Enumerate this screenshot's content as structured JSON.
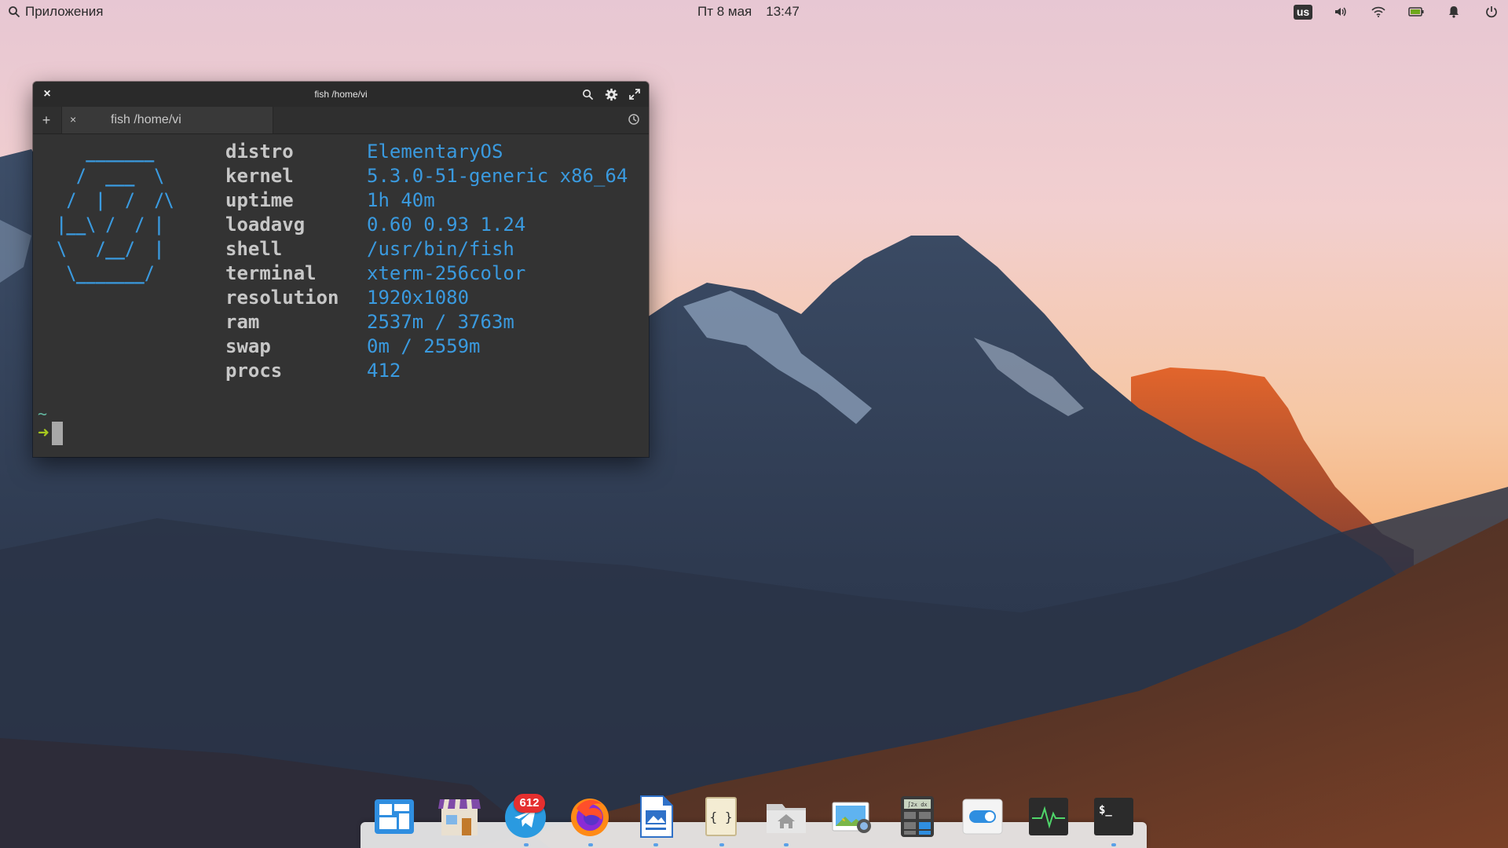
{
  "panel": {
    "apps_label": "Приложения",
    "date": "Пт  8 мая",
    "time": "13:47",
    "keyboard_layout": "us",
    "indicators": [
      "volume-icon",
      "wifi-icon",
      "battery-icon",
      "notifications-icon",
      "power-icon"
    ]
  },
  "terminal": {
    "window_title": "fish  /home/vi",
    "tab_label": "fish  /home/vi",
    "new_tab": "+",
    "tab_close": "×",
    "close": "×",
    "ascii_logo": "   _______\n  /  ___  \\\n /  |  /  /\\\n|__\\ /  / |\n\\   /__/  |\n \\_______/",
    "info": [
      {
        "key": "distro",
        "value": "ElementaryOS"
      },
      {
        "key": "kernel",
        "value": "5.3.0-51-generic x86_64"
      },
      {
        "key": "uptime",
        "value": "1h 40m"
      },
      {
        "key": "loadavg",
        "value": "0.60 0.93 1.24"
      },
      {
        "key": "shell",
        "value": "/usr/bin/fish"
      },
      {
        "key": "terminal",
        "value": "xterm-256color"
      },
      {
        "key": "resolution",
        "value": "1920x1080"
      },
      {
        "key": "ram",
        "value": "2537m / 3763m"
      },
      {
        "key": "swap",
        "value": "0m / 2559m"
      },
      {
        "key": "procs",
        "value": "412"
      }
    ],
    "prompt_dir": "~",
    "prompt_arrow": "➜"
  },
  "dock": {
    "items": [
      "multitasking-view-icon",
      "appcenter-icon",
      "telegram-icon",
      "firefox-icon",
      "writer-icon",
      "code-editor-icon",
      "files-icon",
      "photos-icon",
      "calculator-icon",
      "settings-icon",
      "system-monitor-icon",
      "terminal-icon"
    ],
    "telegram_badge": "612"
  },
  "colors": {
    "accent_blue": "#3a9adf",
    "prompt_green": "#a7c91e",
    "terminal_bg": "#333333"
  }
}
